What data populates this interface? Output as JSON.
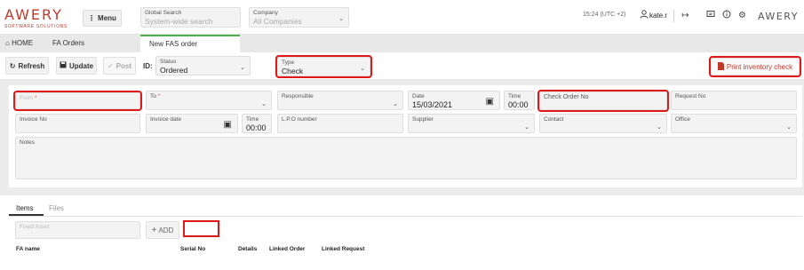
{
  "header": {
    "logo_main": "AWERY",
    "logo_sub": "SOFTWARE SOLUTIONS",
    "menu_label": "Menu",
    "global_search_label": "Global Search",
    "global_search_placeholder": "System-wide search",
    "company_label": "Company",
    "company_value": "All Companies",
    "clock": "15:24 (UTC +2)",
    "user": "kate.r",
    "brand_right": "AWERY"
  },
  "tabs": [
    {
      "label": "HOME"
    },
    {
      "label": "FA Orders"
    },
    {
      "label": "New FAS order"
    }
  ],
  "toolbar": {
    "refresh": "Refresh",
    "update": "Update",
    "post": "Post",
    "id_label": "ID:",
    "status_label": "Status",
    "status_value": "Ordered",
    "type_label": "Type",
    "type_value": "Check",
    "print_label": "Print inventory check"
  },
  "form": {
    "from_label": "From",
    "to_label": "To",
    "responsible_label": "Responsible",
    "date_label": "Date",
    "date_value": "15/03/2021",
    "time_label": "Time",
    "time_value": "00:00",
    "check_order_label": "Check Order No",
    "request_no_label": "Request No",
    "invoice_no_label": "Invoice No",
    "invoice_date_label": "Invoice date",
    "invoice_time_label": "Time",
    "invoice_time_value": "00:00",
    "lpo_label": "L.P.O number",
    "supplier_label": "Supplier",
    "contact_label": "Contact",
    "office_label": "Office",
    "notes_label": "Notes",
    "required_mark": "*"
  },
  "items": {
    "tab_items": "Items",
    "tab_files": "Files",
    "asset_placeholder": "Fixed Asset",
    "add_label": "ADD",
    "columns": [
      "FA name",
      "Serial No",
      "Details",
      "Linked Order",
      "Linked Request"
    ]
  },
  "colors": {
    "accent_green": "#4caf50",
    "brand_red": "#c0392b",
    "highlight_red": "#e01818"
  }
}
